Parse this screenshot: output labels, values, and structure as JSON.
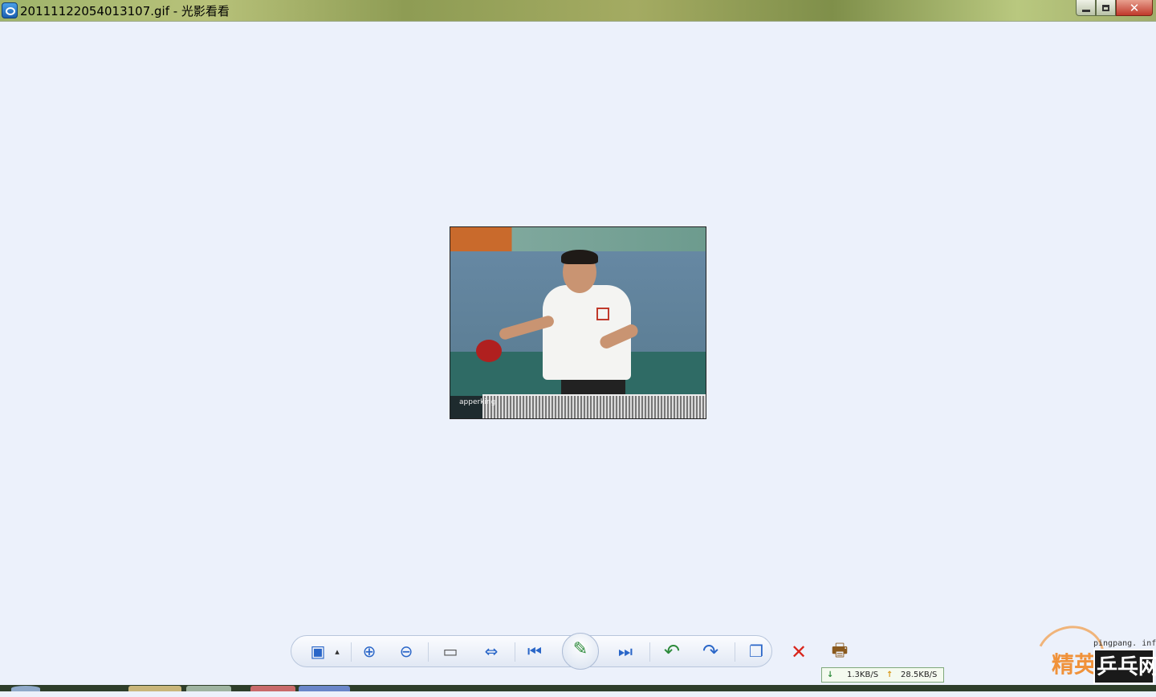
{
  "window": {
    "title": "20111122054013107.gif - 光影看看",
    "buttons": {
      "minimize": "",
      "maximize": "",
      "close": "✕"
    }
  },
  "image": {
    "watermark_text": "apperking"
  },
  "toolbar": {
    "items": [
      {
        "name": "slideshow",
        "icon": "picture-icon",
        "glyph": "▣"
      },
      {
        "name": "slideshow-dropdown",
        "icon": "triangle-up-icon",
        "glyph": "▴"
      },
      {
        "name": "zoom-in",
        "icon": "zoom-in-icon",
        "glyph": "⊕"
      },
      {
        "name": "zoom-out",
        "icon": "zoom-out-icon",
        "glyph": "⊖"
      },
      {
        "name": "actual-size",
        "icon": "actual-size-icon",
        "glyph": "▭"
      },
      {
        "name": "fit-window",
        "icon": "fit-window-icon",
        "glyph": "⇔"
      },
      {
        "name": "previous",
        "icon": "previous-icon",
        "glyph": "⏮"
      },
      {
        "name": "edit",
        "icon": "edit-icon",
        "glyph": "✎"
      },
      {
        "name": "next",
        "icon": "next-icon",
        "glyph": "⏭"
      },
      {
        "name": "rotate-left",
        "icon": "rotate-left-icon",
        "glyph": "↶"
      },
      {
        "name": "rotate-right",
        "icon": "rotate-right-icon",
        "glyph": "↷"
      },
      {
        "name": "copy",
        "icon": "copy-icon",
        "glyph": "❐"
      },
      {
        "name": "delete",
        "icon": "delete-icon",
        "glyph": "✕"
      }
    ],
    "extra": {
      "name": "print",
      "icon": "print-icon",
      "glyph": "🖶"
    }
  },
  "netspeed": {
    "download_arrow": "↓",
    "download": "1.3KB/S",
    "upload_arrow": "↑",
    "upload": "28.5KB/S"
  },
  "site_watermark": {
    "url": "pingpang. info",
    "name_part1": "精英",
    "name_part2": "乒乓网"
  },
  "colors": {
    "background": "#ecf1fb",
    "delete": "#d9261c",
    "rotate": "#2c8a3a",
    "nav": "#2a66c8"
  }
}
